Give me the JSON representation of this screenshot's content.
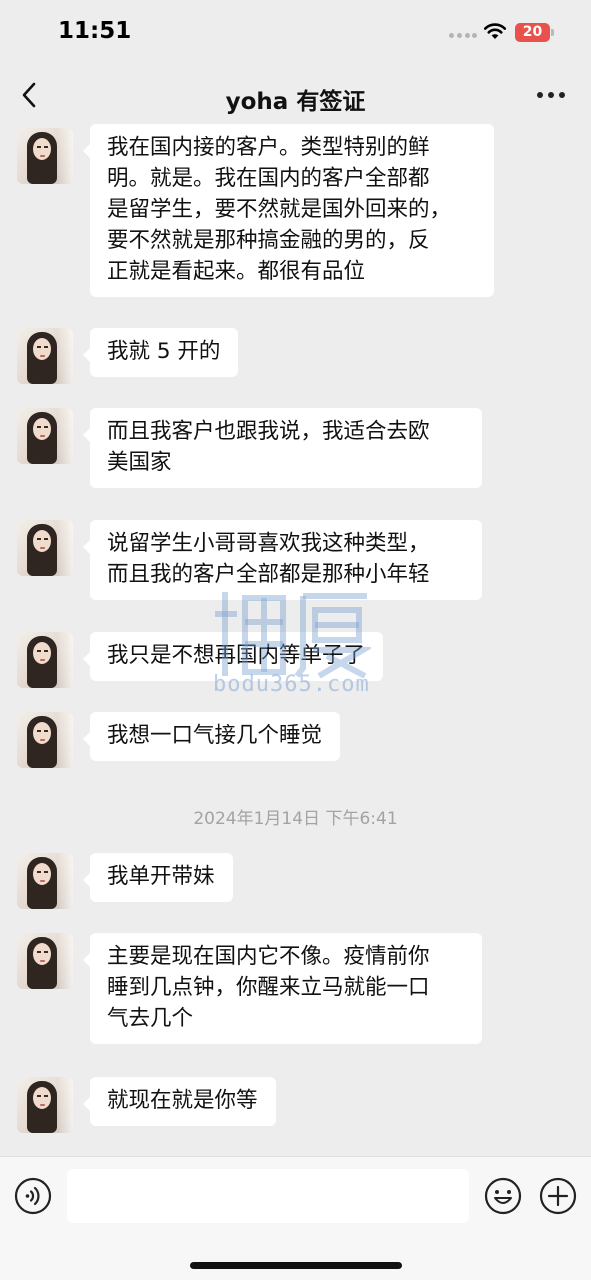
{
  "status_bar": {
    "time": "11:51",
    "battery": "20"
  },
  "nav": {
    "title": "yoha 有签证"
  },
  "messages": [
    "我在国内接的客户。类型特别的鲜\n明。就是。我在国内的客户全部都\n是留学生，要不然就是国外回来的，\n要不然就是那种搞金融的男的，反\n正就是看起来。都很有品位",
    "我就 5 开的",
    "而且我客户也跟我说，我适合去欧\n美国家",
    "说留学生小哥哥喜欢我这种类型，\n而且我的客户全部都是那种小年轻",
    "我只是不想再国内等单子了",
    "我想一口气接几个睡觉",
    "我单开带妹",
    "主要是现在国内它不像。疫情前你\n睡到几点钟，你醒来立马就能一口\n气去几个",
    "就现在就是你等"
  ],
  "timestamp": "2024年1月14日 下午6:41",
  "watermark": {
    "text": "bodu365.com"
  },
  "input": {
    "placeholder": ""
  }
}
